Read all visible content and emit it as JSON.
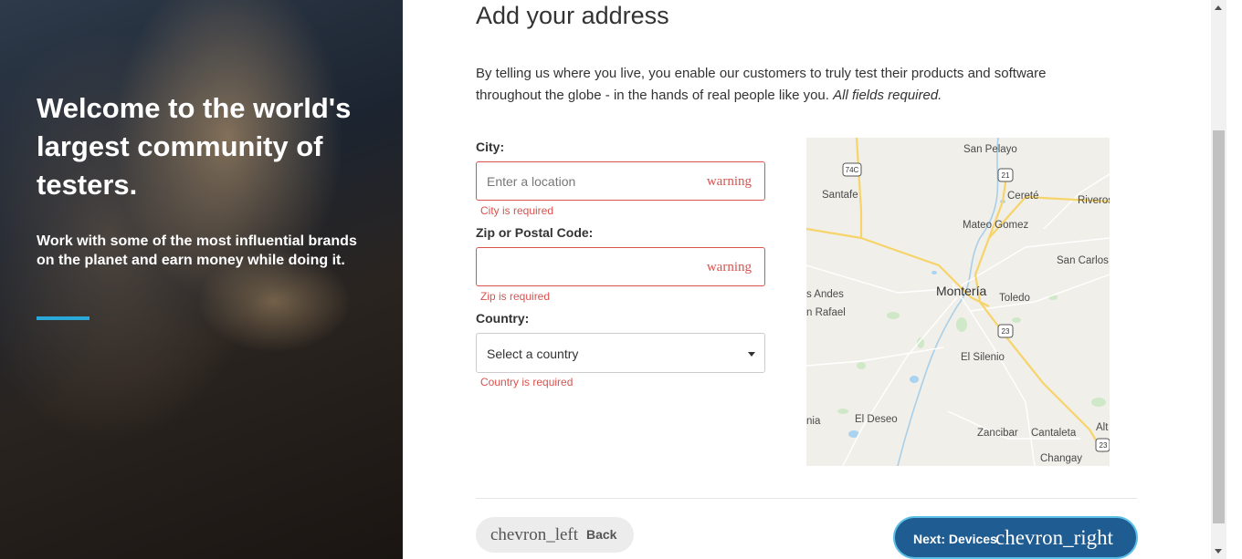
{
  "hero": {
    "title": "Welcome to the world's largest community of testers.",
    "subtitle": "Work with some of the most influential brands on the planet and earn money while doing it."
  },
  "form": {
    "title": "Add your address",
    "intro": "By telling us where you live, you enable our customers to truly test their products and software throughout the globe - in the hands of real people like you.",
    "intro_emphasis": "All fields required.",
    "city": {
      "label": "City:",
      "placeholder": "Enter a location",
      "warning_icon": "warning",
      "error": "City is required"
    },
    "zip": {
      "label": "Zip or Postal Code:",
      "value": "",
      "warning_icon": "warning",
      "error": "Zip is required"
    },
    "country": {
      "label": "Country:",
      "selected": "Select a country",
      "error": "Country is required"
    }
  },
  "map": {
    "labels": {
      "san_pelayo": "San Pelayo",
      "santafe": "Santafe",
      "cerete": "Cereté",
      "riveros": "Riveros",
      "mateo_gomez": "Mateo Gomez",
      "san_carlos": "San Carlos",
      "andes": "s Andes",
      "rafael": "n Rafael",
      "monteria": "Montería",
      "toledo": "Toledo",
      "el_silenio": "El Silenio",
      "nia": "nia",
      "el_deseo": "El Deseo",
      "zancibar": "Zancibar",
      "cantaleta": "Cantaleta",
      "alt": "Alt",
      "changay": "Changay"
    },
    "shields": {
      "r74c": "74C",
      "r21": "21",
      "r23a": "23",
      "r23b": "23"
    }
  },
  "nav": {
    "back_icon": "chevron_left",
    "back_label": "Back",
    "next_label": "Next: Devices",
    "next_icon": "chevron_right"
  },
  "colors": {
    "error": "#d9534f",
    "accent": "#2aa8d8",
    "primary_button": "#1f5c91"
  }
}
